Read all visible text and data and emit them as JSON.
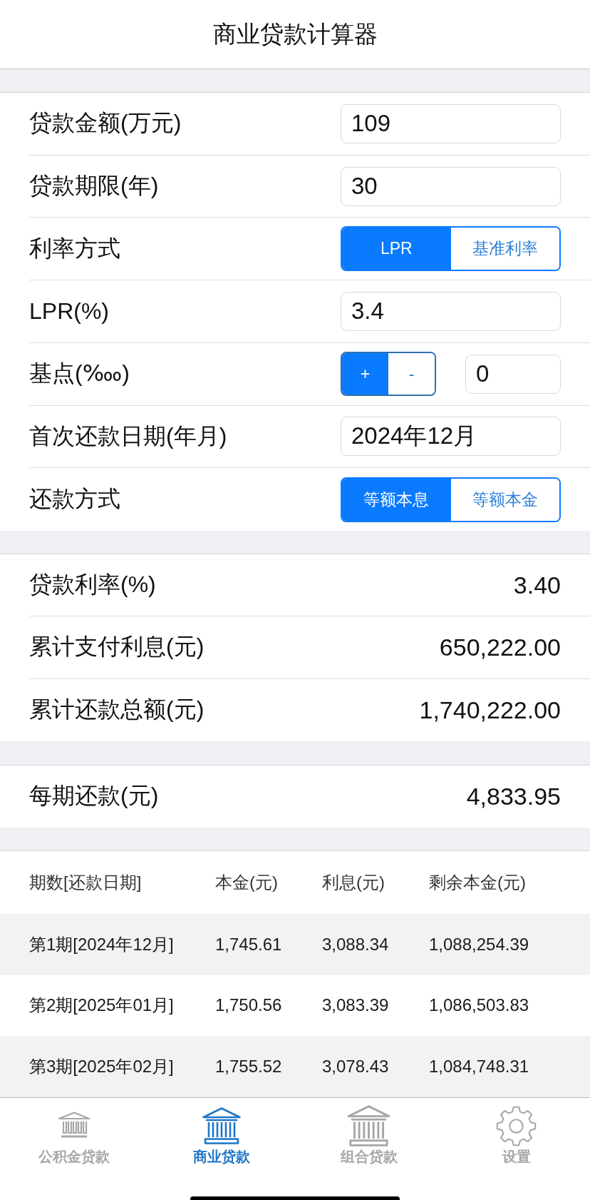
{
  "header": {
    "title": "商业贷款计算器"
  },
  "form": [
    {
      "kind": "input",
      "label": "贷款金额(万元)",
      "value": "109"
    },
    {
      "kind": "input",
      "label": "贷款期限(年)",
      "value": "30"
    },
    {
      "kind": "segmented",
      "label": "利率方式",
      "options": [
        {
          "label": "LPR",
          "selected": true
        },
        {
          "label": "基准利率",
          "selected": false
        }
      ]
    },
    {
      "kind": "input",
      "label": "LPR(%)",
      "value": "3.4"
    },
    {
      "kind": "stepper",
      "label": "基点(‱)",
      "options": [
        {
          "label": "+",
          "selected": true
        },
        {
          "label": "-",
          "selected": false
        }
      ],
      "value": "0"
    },
    {
      "kind": "input",
      "label": "首次还款日期(年月)",
      "value": "2024年12月"
    },
    {
      "kind": "segmented",
      "label": "还款方式",
      "options": [
        {
          "label": "等额本息",
          "selected": true
        },
        {
          "label": "等额本金",
          "selected": false
        }
      ]
    }
  ],
  "results": [
    {
      "label": "贷款利率(%)",
      "value": "3.40"
    },
    {
      "label": "累计支付利息(元)",
      "value": "650,222.00"
    },
    {
      "label": "累计还款总额(元)",
      "value": "1,740,222.00"
    }
  ],
  "installment": {
    "label": "每期还款(元)",
    "value": "4,833.95"
  },
  "schedule": {
    "columns": [
      "期数[还款日期]",
      "本金(元)",
      "利息(元)",
      "剩余本金(元)"
    ],
    "rows": [
      [
        "第1期[2024年12月]",
        "1,745.61",
        "3,088.34",
        "1,088,254.39"
      ],
      [
        "第2期[2025年01月]",
        "1,750.56",
        "3,083.39",
        "1,086,503.83"
      ],
      [
        "第3期[2025年02月]",
        "1,755.52",
        "3,078.43",
        "1,084,748.31"
      ]
    ]
  },
  "tab_bar": [
    {
      "kind": "fund",
      "label": "公积金贷款",
      "selected": false
    },
    {
      "kind": "bank",
      "label": "商业贷款",
      "selected": true
    },
    {
      "kind": "combo",
      "label": "组合贷款",
      "selected": false
    },
    {
      "kind": "settings",
      "label": "设置",
      "selected": false
    }
  ]
}
